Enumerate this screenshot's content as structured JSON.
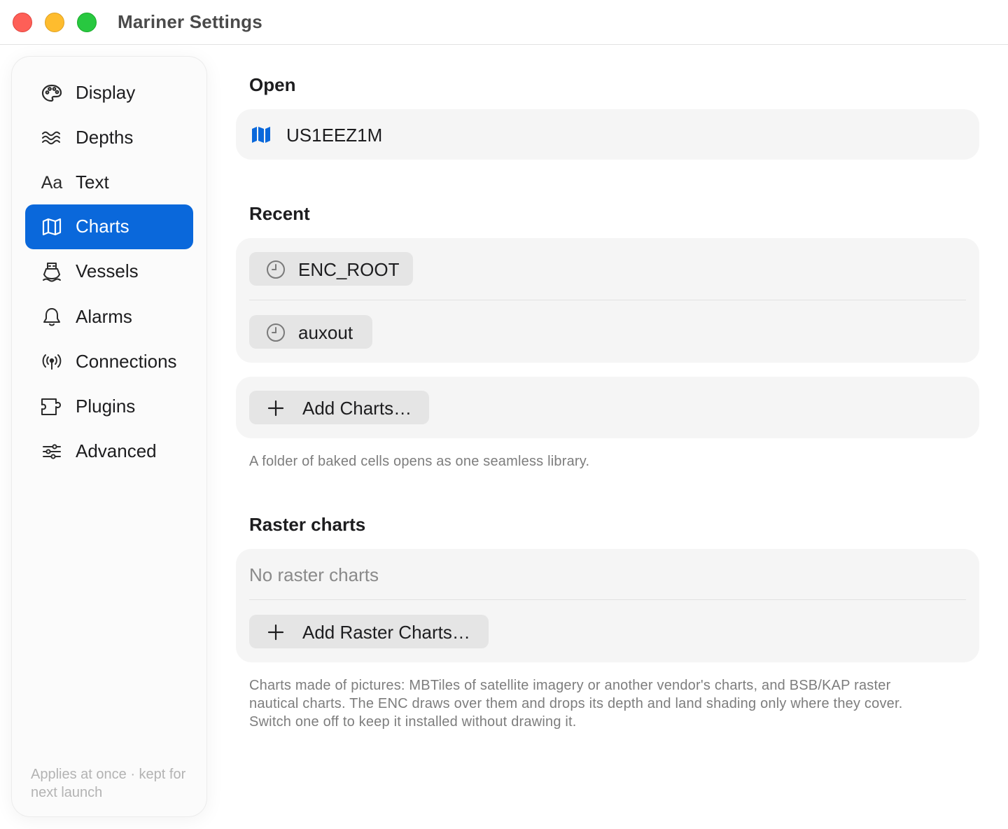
{
  "window": {
    "title": "Mariner Settings"
  },
  "sidebar": {
    "items": [
      {
        "label": "Display",
        "icon": "palette-icon"
      },
      {
        "label": "Depths",
        "icon": "waves-icon"
      },
      {
        "label": "Text",
        "icon": "text-size-icon",
        "glyph": "Aa"
      },
      {
        "label": "Charts",
        "icon": "map-icon",
        "selected": true
      },
      {
        "label": "Vessels",
        "icon": "ferry-icon"
      },
      {
        "label": "Alarms",
        "icon": "bell-icon"
      },
      {
        "label": "Connections",
        "icon": "antenna-icon"
      },
      {
        "label": "Plugins",
        "icon": "puzzle-icon"
      },
      {
        "label": "Advanced",
        "icon": "sliders-icon"
      }
    ],
    "footer": "Applies at once · kept for next launch"
  },
  "open": {
    "heading": "Open",
    "chart_name": "US1EEZ1M",
    "icon": "map-fill-icon"
  },
  "recent": {
    "heading": "Recent",
    "items": [
      {
        "label": "ENC_ROOT",
        "icon": "clock-icon"
      },
      {
        "label": "auxout",
        "icon": "clock-icon"
      }
    ]
  },
  "add_charts": {
    "label": "Add Charts…",
    "icon": "plus-icon",
    "help": "A folder of baked cells opens as one seamless library."
  },
  "raster": {
    "heading": "Raster charts",
    "empty_text": "No raster charts",
    "add_label": "Add Raster Charts…",
    "help_lines": [
      "Charts made of pictures: MBTiles of satellite imagery or another vendor's charts, and BSB/KAP raster",
      "nautical charts. The ENC draws over them and drops its depth and land shading only where they cover.",
      "Switch one off to keep it installed without drawing it."
    ]
  },
  "colors": {
    "accent": "#0a68db",
    "close": "#fe5f57",
    "minimize": "#febc2e",
    "zoom": "#28c840"
  }
}
